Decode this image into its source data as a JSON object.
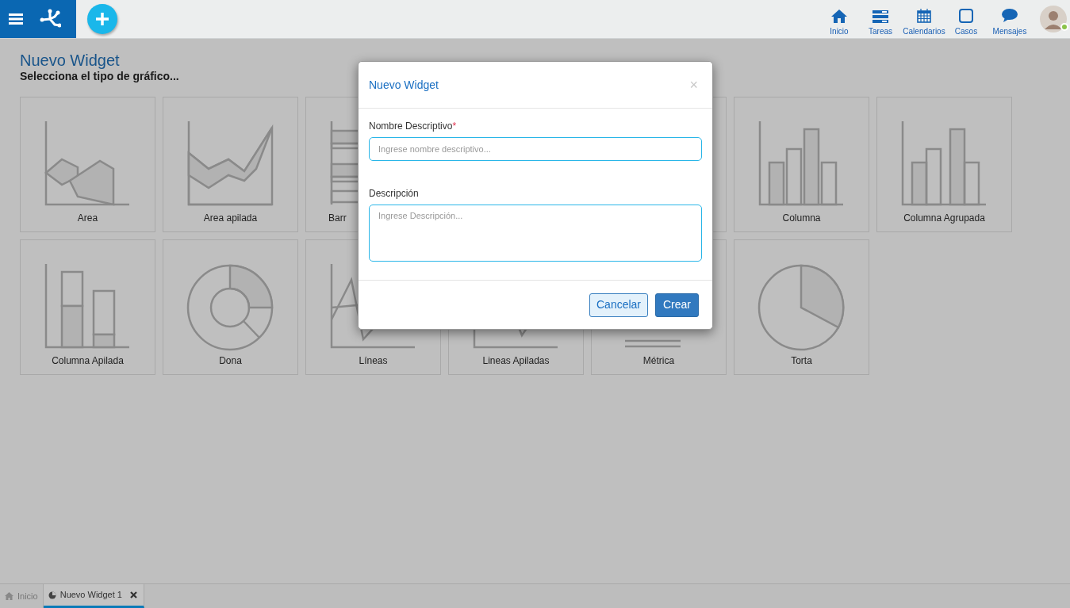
{
  "topbar": {
    "nav": [
      {
        "label": "Inicio",
        "kind": "home"
      },
      {
        "label": "Tareas",
        "kind": "tasks"
      },
      {
        "label": "Calendarios",
        "kind": "calendar"
      },
      {
        "label": "Casos",
        "kind": "cases"
      },
      {
        "label": "Mensajes",
        "kind": "messages"
      }
    ],
    "user": {
      "online": true
    }
  },
  "page": {
    "title": "Nuevo Widget",
    "subtitle": "Selecciona el tipo de gráfico...",
    "tiles": [
      {
        "label": "Area",
        "kind": "area",
        "clipped": false
      },
      {
        "label": "Area apilada",
        "kind": "stacked-area",
        "clipped": false
      },
      {
        "label": "Barr",
        "kind": "bar",
        "clipped": true
      },
      {
        "kind": "hidden"
      },
      {
        "label": "Columna",
        "kind": "column",
        "clipped": false
      },
      {
        "label": "Columna Agrupada",
        "kind": "grouped-column",
        "clipped": false
      },
      {
        "label": "Columna Apilada",
        "kind": "stacked-column",
        "clipped": false
      },
      {
        "label": "Dona",
        "kind": "donut",
        "clipped": false
      },
      {
        "label": "Líneas",
        "kind": "lines",
        "clipped": false
      },
      {
        "label": "Lineas Apiladas",
        "kind": "stacked-lines",
        "clipped": false
      },
      {
        "label": "Métrica",
        "kind": "metric",
        "clipped": false
      },
      {
        "label": "Torta",
        "kind": "pie",
        "clipped": false
      }
    ]
  },
  "modal": {
    "title": "Nuevo Widget",
    "close": "×",
    "fields": [
      {
        "label": "Nombre Descriptivo",
        "required_mark": "*",
        "kind": "input",
        "placeholder": "Ingrese nombre descriptivo..."
      },
      {
        "label": "Descripción",
        "kind": "textarea",
        "placeholder": "Ingrese Descripción..."
      }
    ],
    "buttons": [
      {
        "label": "Cancelar",
        "kind": "secondary"
      },
      {
        "label": "Crear",
        "kind": "primary"
      }
    ]
  },
  "bottom_tabs": [
    {
      "label": "Inicio",
      "kind": "home",
      "selected": false,
      "closable": false
    },
    {
      "label": "Nuevo Widget 1",
      "kind": "widget",
      "selected": true,
      "closable": true
    }
  ]
}
